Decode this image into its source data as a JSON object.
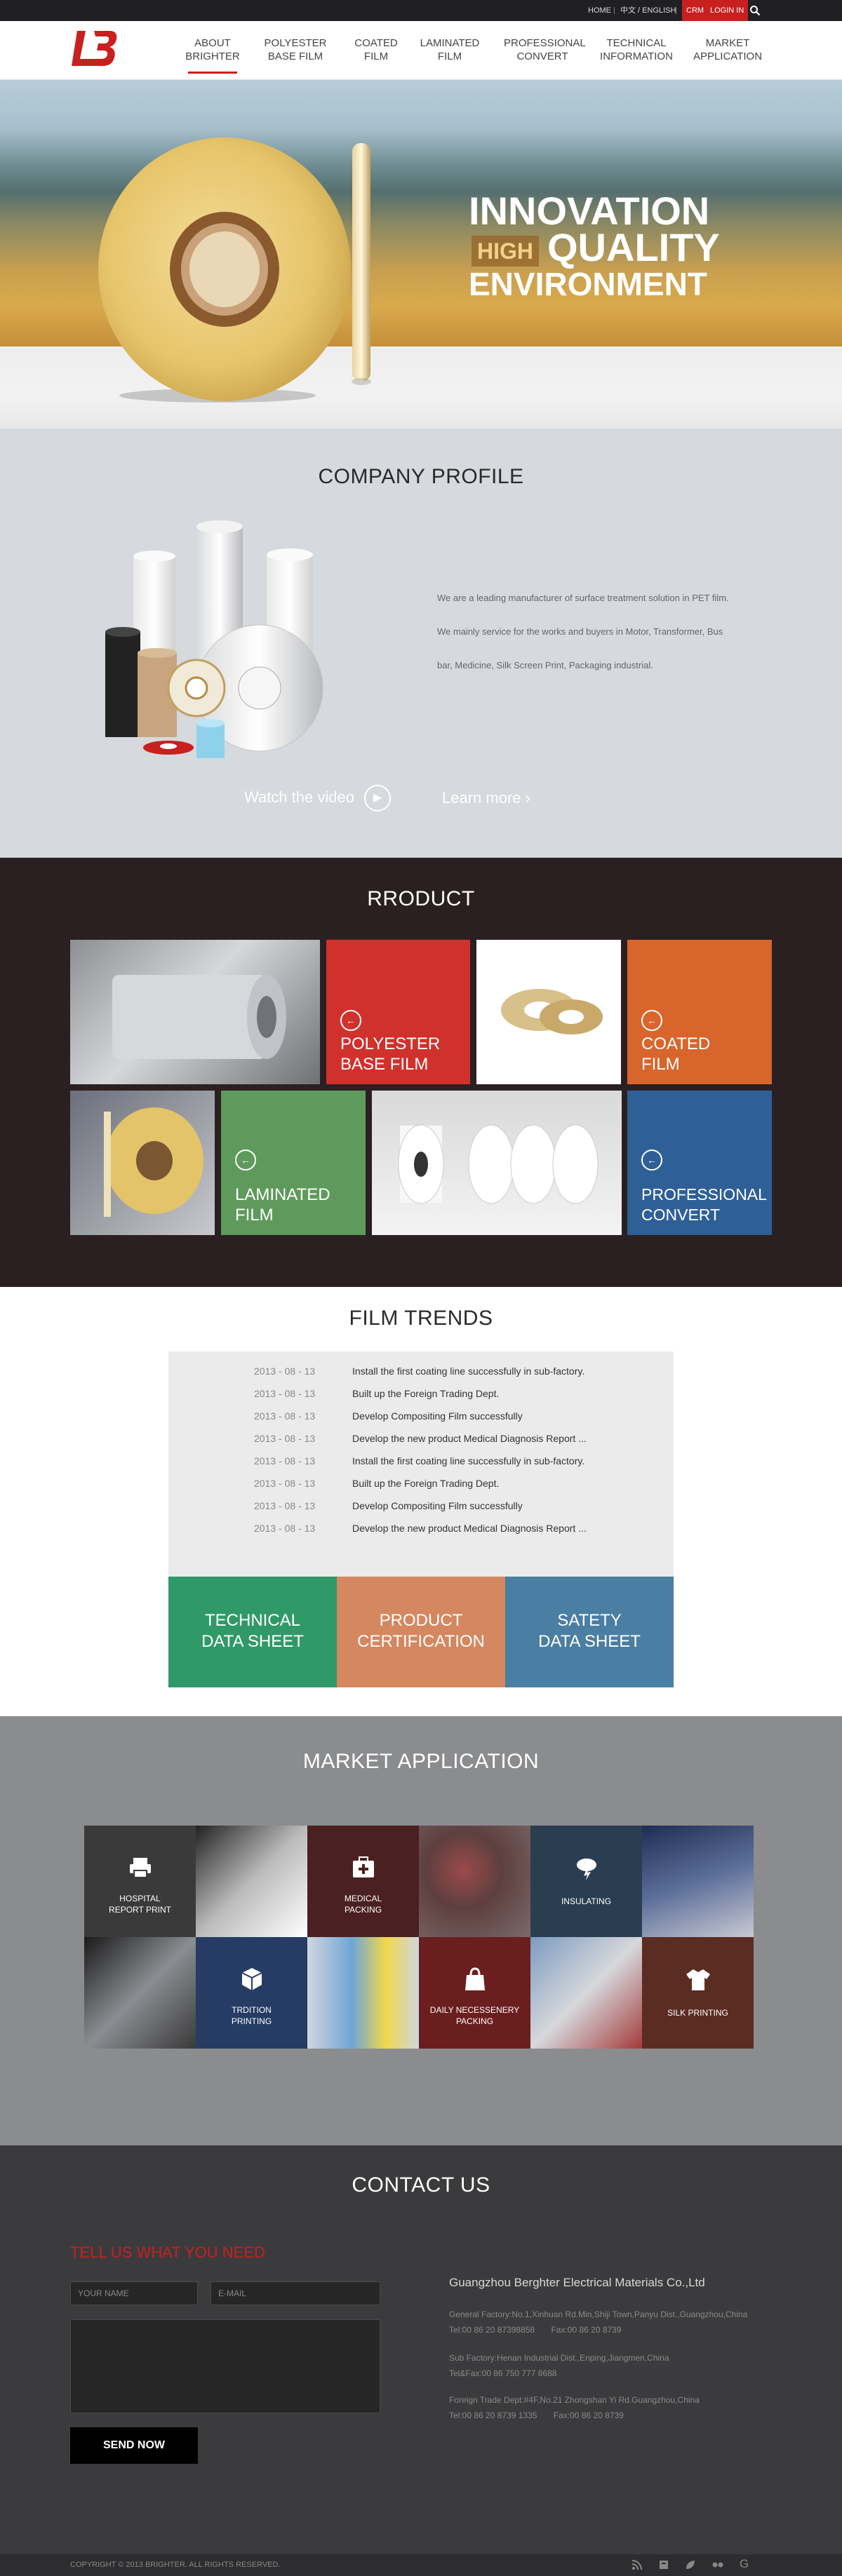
{
  "topbar": {
    "home": "HOME",
    "lang": "中文 / ENGLISH",
    "crm": "CRM",
    "login": "LOGIN IN",
    "search_icon": "search-icon"
  },
  "brand": {
    "logo_text": "LB",
    "color": "#c8201f"
  },
  "nav": [
    {
      "line1": "ABOUT",
      "line2": "BRIGHTER",
      "active": true
    },
    {
      "line1": "POLYESTER",
      "line2": "BASE FILM"
    },
    {
      "line1": "COATED",
      "line2": "FILM"
    },
    {
      "line1": "LAMINATED",
      "line2": "FILM"
    },
    {
      "line1": "PROFESSIONAL",
      "line2": "CONVERT"
    },
    {
      "line1": "TECHNICAL",
      "line2": "INFORMATION"
    },
    {
      "line1": "MARKET",
      "line2": "APPLICATION"
    }
  ],
  "hero": {
    "line1": "INNOVATION",
    "high": "HIGH",
    "quality": "QUALITY",
    "line3": "ENVIRONMENT"
  },
  "profile": {
    "title": "COMPANY PROFILE",
    "text": [
      "We are a leading manufacturer of surface treatment solution in PET film.",
      "We mainly service for the works and buyers in Motor, Transformer, Bus",
      "bar, Medicine, Silk Screen Print, Packaging industrial."
    ],
    "watch": "Watch the video",
    "learn": "Learn more"
  },
  "product": {
    "title": "RRODUCT",
    "tiles": [
      {
        "line1": "POLYESTER",
        "line2": "BASE FILM",
        "color": "#d0312d"
      },
      {
        "line1": "COATED",
        "line2": "FILM",
        "color": "#d8662c"
      },
      {
        "line1": "LAMINATED",
        "line2": "FILM",
        "color": "#5e9a5c"
      },
      {
        "line1": "PROFESSIONAL",
        "line2": "CONVERT",
        "color": "#2f5f97"
      }
    ]
  },
  "trends": {
    "title": "FILM TRENDS",
    "items": [
      {
        "date": "2013 - 08 - 13",
        "text": "Install the first coating line successfully in sub-factory."
      },
      {
        "date": "2013 - 08 - 13",
        "text": "Built up the Foreign Trading Dept."
      },
      {
        "date": "2013 - 08 - 13",
        "text": "Develop Compositing Film successfully"
      },
      {
        "date": "2013 - 08 - 13",
        "text": "Develop the new product Medical Diagnosis Report ..."
      },
      {
        "date": "2013 - 08 - 13",
        "text": "Install the first coating line successfully in sub-factory."
      },
      {
        "date": "2013 - 08 - 13",
        "text": "Built up the Foreign Trading Dept."
      },
      {
        "date": "2013 - 08 - 13",
        "text": "Develop Compositing Film successfully"
      },
      {
        "date": "2013 - 08 - 13",
        "text": "Develop the new product Medical Diagnosis Report ..."
      }
    ],
    "sheets": [
      {
        "line1": "TECHNICAL",
        "line2": "DATA SHEET",
        "color": "#2f9a68"
      },
      {
        "line1": "PRODUCT",
        "line2": "CERTIFICATION",
        "color": "#d5875f"
      },
      {
        "line1": "SATETY",
        "line2": "DATA SHEET",
        "color": "#4a7ea2"
      }
    ]
  },
  "market": {
    "title": "MARKET APPLICATION",
    "cells": [
      {
        "line1": "HOSPITAL",
        "line2": "REPORT PRINT",
        "icon": "printer-icon",
        "color": "#3a3a3a"
      },
      {
        "line1": "MEDICAL",
        "line2": "PACKING",
        "icon": "medical-kit-icon",
        "color": "#4b2020"
      },
      {
        "line1": "INSULATING",
        "line2": "",
        "icon": "cloud-bolt-icon",
        "color": "#2a3e52"
      },
      {
        "line1": "TRDITION",
        "line2": "PRINTING",
        "icon": "box-icon",
        "color": "#263c64"
      },
      {
        "line1": "DAILY NECESSENERY",
        "line2": "PACKING",
        "icon": "bag-icon",
        "color": "#6b1e1e"
      },
      {
        "line1": "SILK PRINTING",
        "line2": "",
        "icon": "tshirt-icon",
        "color": "#5a2c22"
      }
    ]
  },
  "contact": {
    "title": "CONTACT US",
    "form_title": "TELL US WHAT YOU NEED",
    "name_placeholder": "YOUR NAME",
    "email_placeholder": "E-MAIL",
    "send": "SEND NOW",
    "company": "Guangzhou Berghter Electrical Materials Co.,Ltd",
    "addresses": [
      {
        "line1": "General Factory:No.1,Xinhuan Rd.Min,Shiji Town,Panyu Dist.,Guangzhou,China",
        "line2": "Tel:00 86 20 87398858       Fax:00 86 20 8739"
      },
      {
        "line1": "Sub Factory:Henan Industrial Dist.,Enping,Jiangmen,China",
        "line2": "Tel&Fax:00 86 750 777 8688"
      },
      {
        "line1": "Foreign Trade Dept:#4F,No.21 Zhongshan Yi Rd.Guangzhou,China",
        "line2": "Tel:00 86 20 8739 1335       Fax:00 86 20 8739"
      }
    ]
  },
  "footer": {
    "copyright": "COPYRIGHT © 2013 BRIGHTER. ALL RIGHTS RESERVED.",
    "icons": [
      "rss-icon",
      "book-icon",
      "leaf-icon",
      "flickr-icon",
      "google-icon"
    ]
  }
}
